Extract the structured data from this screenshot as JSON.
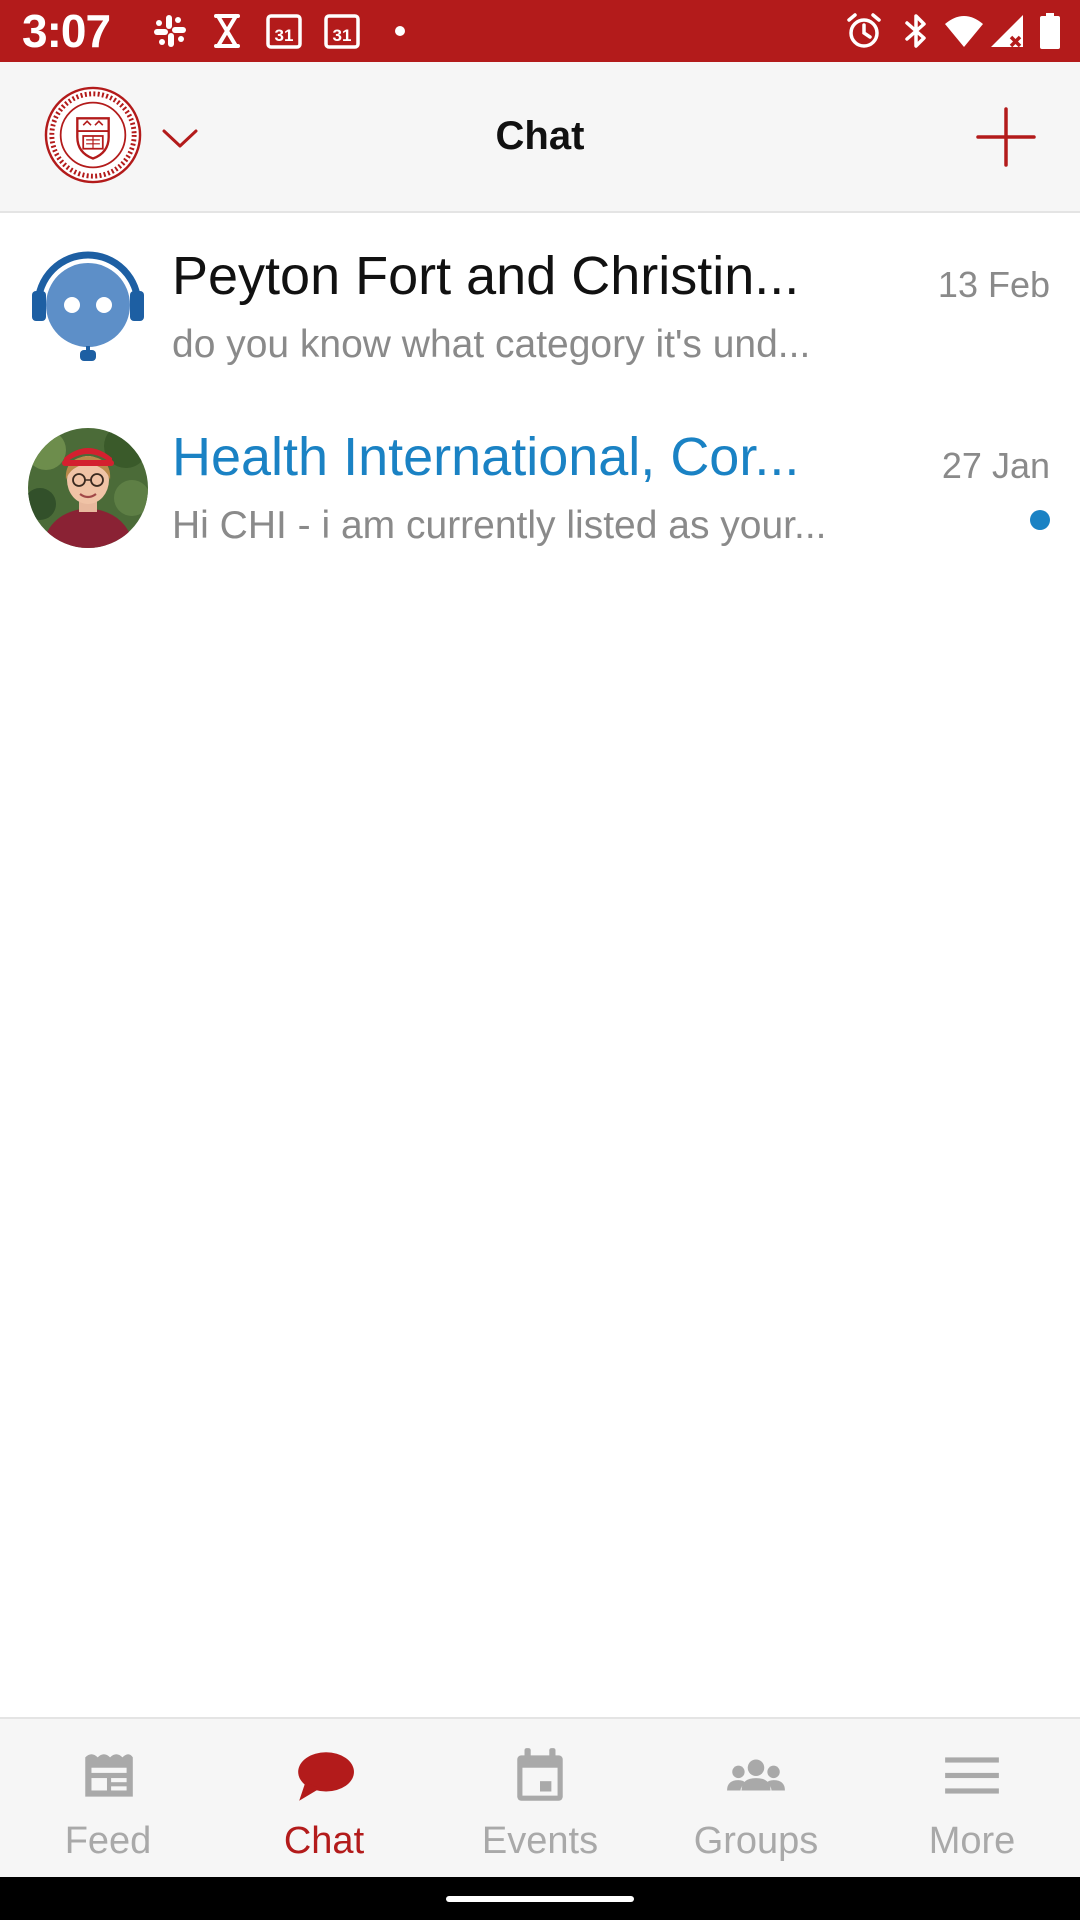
{
  "status_bar": {
    "time": "3:07",
    "calendar_day": "31",
    "background": "#b31b1b",
    "left_icons": [
      "slack-icon",
      "hourglass-icon",
      "calendar-icon",
      "calendar-icon",
      "dot-icon"
    ],
    "right_icons": [
      "alarm-icon",
      "bluetooth-icon",
      "wifi-icon",
      "signal-icon",
      "battery-icon"
    ]
  },
  "header": {
    "title": "Chat",
    "logo": "cornell-seal-logo",
    "dropdown_icon": "chevron-down-icon",
    "add_icon": "plus-icon",
    "accent": "#b31b1b"
  },
  "chats": [
    {
      "name": "Peyton Fort and Christin...",
      "preview": "do you know what category it's und...",
      "date": "13 Feb",
      "unread": false,
      "avatar": "bot-avatar"
    },
    {
      "name": "Health International, Cor...",
      "preview": "Hi CHI - i am currently listed as your...",
      "date": "27 Jan",
      "unread": true,
      "avatar": "user-photo-avatar"
    }
  ],
  "unread_color": "#1a82c4",
  "bottom_nav": {
    "items": [
      {
        "label": "Feed",
        "icon": "feed-icon",
        "active": false
      },
      {
        "label": "Chat",
        "icon": "chat-bubble-icon",
        "active": true
      },
      {
        "label": "Events",
        "icon": "calendar-icon",
        "active": false
      },
      {
        "label": "Groups",
        "icon": "groups-icon",
        "active": false
      },
      {
        "label": "More",
        "icon": "menu-icon",
        "active": false
      }
    ],
    "active_color": "#b31b1b",
    "inactive_color": "#a9a9a9"
  }
}
